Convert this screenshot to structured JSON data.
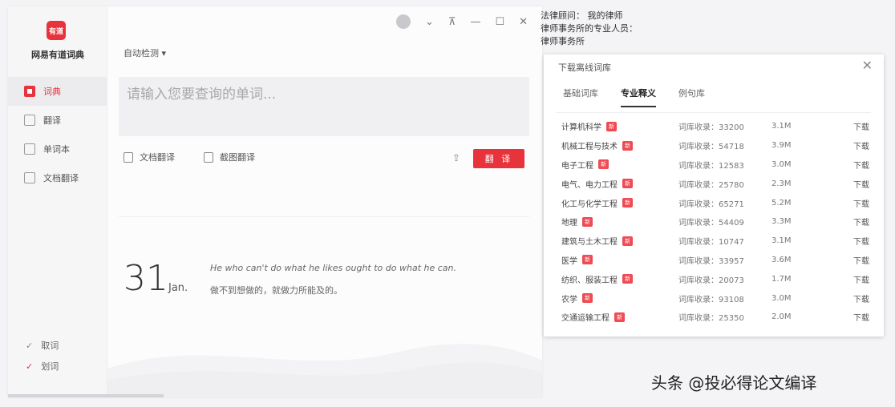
{
  "app": {
    "logo_text": "有道",
    "name": "网易有道词典",
    "nav": [
      {
        "label": "词典",
        "icon": "dictionary-icon",
        "active": true
      },
      {
        "label": "翻译",
        "icon": "translate-icon",
        "active": false
      },
      {
        "label": "单词本",
        "icon": "wordbook-icon",
        "active": false
      },
      {
        "label": "文档翻译",
        "icon": "document-icon",
        "active": false
      }
    ],
    "bottom_options": [
      {
        "label": "取词",
        "checked": true
      },
      {
        "label": "划词",
        "checked": true
      }
    ]
  },
  "window_controls": {
    "dropdown": "⌄",
    "pin": "⊼",
    "minimize": "—",
    "maximize": "☐",
    "close": "✕"
  },
  "main": {
    "language_select": "自动检测 ▾",
    "search_placeholder": "请输入您要查询的单词...",
    "tools": [
      {
        "label": "文档翻译",
        "icon": "doc-translate-icon"
      },
      {
        "label": "截图翻译",
        "icon": "screenshot-icon"
      }
    ],
    "translate_button": "翻 译",
    "daily": {
      "day": "31",
      "month": "Jan.",
      "sentence_en": "He who can't do what he likes ought to do what he can.",
      "sentence_cn": "做不到想做的，就做力所能及的。"
    }
  },
  "background_text": {
    "line1": "法律顾问：  我的律师",
    "line2": "律师事务所的专业人员：",
    "line3": "律师事务所"
  },
  "dialog": {
    "title": "下载离线词库",
    "close": "✕",
    "tabs": [
      {
        "label": "基础词库",
        "active": false
      },
      {
        "label": "专业释义",
        "active": true
      },
      {
        "label": "例句库",
        "active": false
      }
    ],
    "rows": [
      {
        "name": "计算机科学",
        "tag": "新",
        "info": "词库收录：33200",
        "size": "3.1M",
        "action": "下载"
      },
      {
        "name": "机械工程与技术",
        "tag": "新",
        "info": "词库收录：54718",
        "size": "3.9M",
        "action": "下载"
      },
      {
        "name": "电子工程",
        "tag": "新",
        "info": "词库收录：12583",
        "size": "3.0M",
        "action": "下载"
      },
      {
        "name": "电气、电力工程",
        "tag": "新",
        "info": "词库收录：25780",
        "size": "2.3M",
        "action": "下载"
      },
      {
        "name": "化工与化学工程",
        "tag": "新",
        "info": "词库收录：65271",
        "size": "5.2M",
        "action": "下载"
      },
      {
        "name": "地理",
        "tag": "新",
        "info": "词库收录：54409",
        "size": "3.3M",
        "action": "下载"
      },
      {
        "name": "建筑与土木工程",
        "tag": "新",
        "info": "词库收录：10747",
        "size": "3.1M",
        "action": "下载"
      },
      {
        "name": "医学",
        "tag": "新",
        "info": "词库收录：33957",
        "size": "3.6M",
        "action": "下载"
      },
      {
        "name": "纺织、服装工程",
        "tag": "新",
        "info": "词库收录：20073",
        "size": "1.7M",
        "action": "下载"
      },
      {
        "name": "农学",
        "tag": "新",
        "info": "词库收录：93108",
        "size": "3.0M",
        "action": "下载"
      },
      {
        "name": "交通运输工程",
        "tag": "新",
        "info": "词库收录：25350",
        "size": "2.0M",
        "action": "下载"
      }
    ]
  },
  "watermark": "头条 @投必得论文编译"
}
